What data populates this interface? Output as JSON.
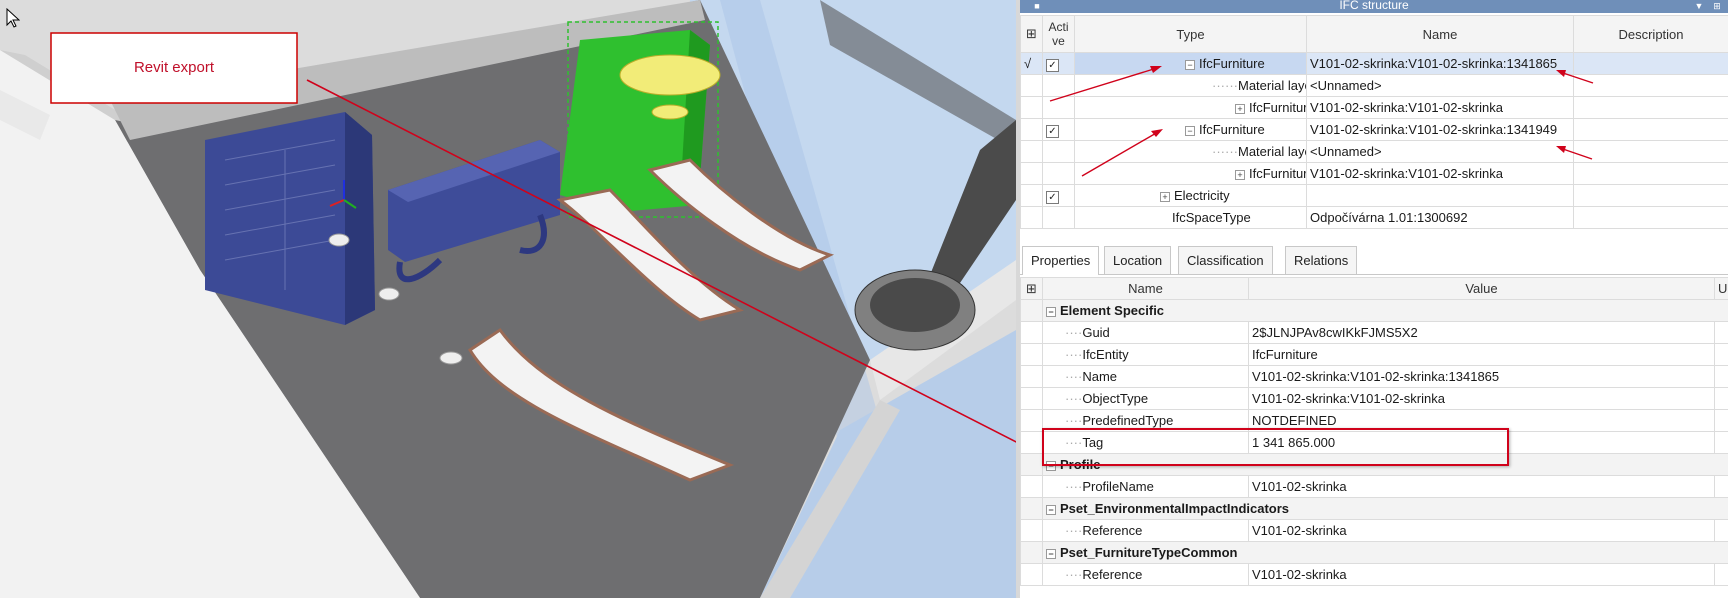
{
  "callout": {
    "label": "Revit export"
  },
  "ifc_panel": {
    "title": "IFC structure",
    "columns": {
      "active": "Acti ve",
      "type": "Type",
      "name": "Name",
      "description": "Description"
    },
    "rows": [
      {
        "mark": "√",
        "checked": true,
        "expander": "−",
        "type": "IfcFurniture",
        "name": "V101-02-skrinka:V101-02-skrinka:1341865"
      },
      {
        "mark": "",
        "checked": false,
        "expander": "",
        "type": "Material layer",
        "name": "<Unnamed>"
      },
      {
        "mark": "",
        "checked": false,
        "expander": "+",
        "type": "IfcFurnitureType",
        "name": "V101-02-skrinka:V101-02-skrinka"
      },
      {
        "mark": "",
        "checked": true,
        "expander": "−",
        "type": "IfcFurniture",
        "name": "V101-02-skrinka:V101-02-skrinka:1341949"
      },
      {
        "mark": "",
        "checked": false,
        "expander": "",
        "type": "Material layer",
        "name": "<Unnamed>"
      },
      {
        "mark": "",
        "checked": false,
        "expander": "+",
        "type": "IfcFurnitureType",
        "name": "V101-02-skrinka:V101-02-skrinka"
      },
      {
        "mark": "",
        "checked": true,
        "expander": "+",
        "type": "Electricity",
        "name": ""
      },
      {
        "mark": "",
        "checked": false,
        "expander": "",
        "type": "IfcSpaceType",
        "name": "Odpočívárna 1.01:1300692"
      }
    ]
  },
  "properties_panel": {
    "tabs": [
      "Properties",
      "Location",
      "Classification",
      "Relations"
    ],
    "columns": {
      "name": "Name",
      "value": "Value",
      "unit": "Unit"
    },
    "rows": [
      {
        "kind": "group",
        "name": "Element Specific",
        "value": ""
      },
      {
        "kind": "prop",
        "name": "Guid",
        "value": "2$JLNJPAv8cwIKkFJMS5X2"
      },
      {
        "kind": "prop",
        "name": "IfcEntity",
        "value": "IfcFurniture"
      },
      {
        "kind": "prop",
        "name": "Name",
        "value": "V101-02-skrinka:V101-02-skrinka:1341865"
      },
      {
        "kind": "prop",
        "name": "ObjectType",
        "value": "V101-02-skrinka:V101-02-skrinka"
      },
      {
        "kind": "prop",
        "name": "PredefinedType",
        "value": "NOTDEFINED"
      },
      {
        "kind": "prop",
        "name": "Tag",
        "value": "1 341 865.000"
      },
      {
        "kind": "group",
        "name": "Profile",
        "value": ""
      },
      {
        "kind": "prop",
        "name": "ProfileName",
        "value": "V101-02-skrinka"
      },
      {
        "kind": "group",
        "name": "Pset_EnvironmentalImpactIndicators",
        "value": ""
      },
      {
        "kind": "prop",
        "name": "Reference",
        "value": "V101-02-skrinka"
      },
      {
        "kind": "group",
        "name": "Pset_FurnitureTypeCommon",
        "value": ""
      },
      {
        "kind": "prop",
        "name": "Reference",
        "value": "V101-02-skrinka"
      }
    ]
  },
  "colors": {
    "annotation": "#d0021b",
    "title_bar": "#6f8fb9",
    "selected_row": "#dbe6f6",
    "cabinet": "#3c4a96",
    "selected_object": "#2fc02f"
  },
  "icons": [
    "cursor-arrow-icon",
    "pin-icon",
    "dropdown-icon",
    "column-chooser-icon",
    "expand-icon",
    "collapse-icon",
    "checkbox-icon",
    "axis-gizmo-icon"
  ]
}
